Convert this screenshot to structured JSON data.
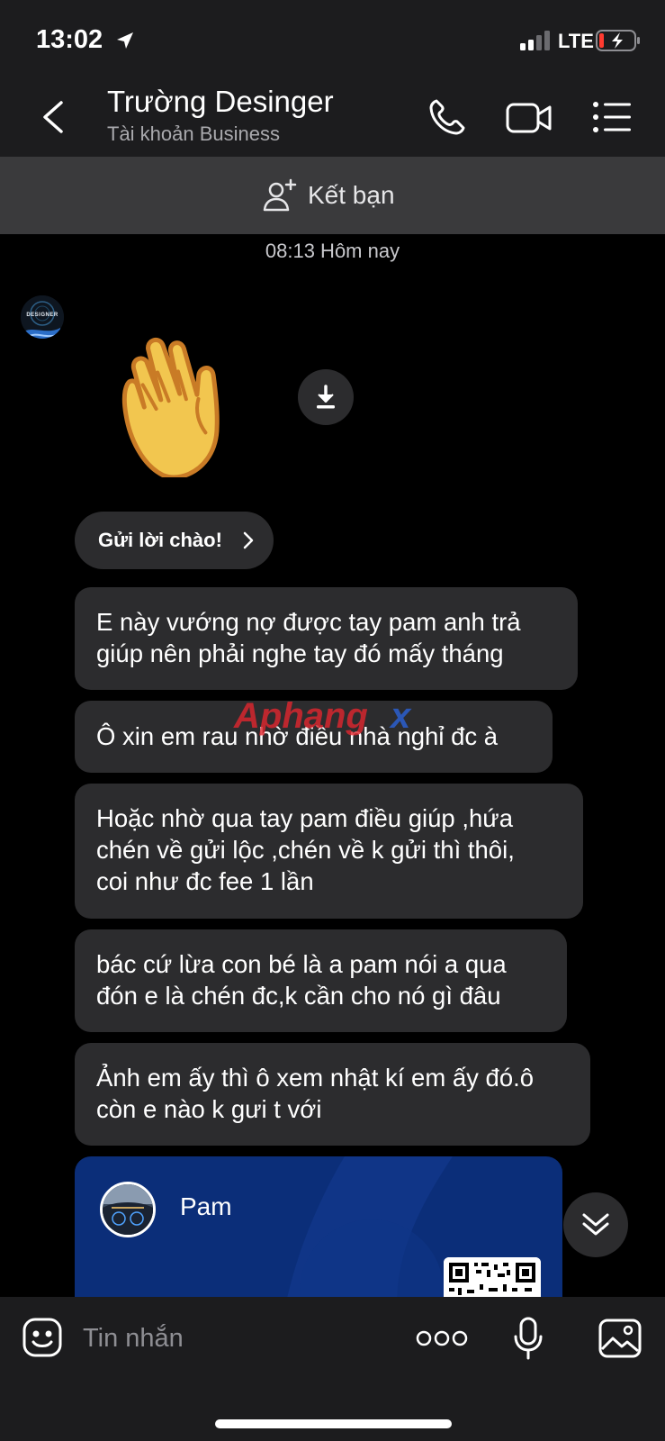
{
  "status_bar": {
    "time": "13:02",
    "network": "LTE"
  },
  "header": {
    "contact_name": "Trường Desinger",
    "contact_subtitle": "Tài khoản Business"
  },
  "add_friend": {
    "label": "Kết bạn"
  },
  "chat": {
    "timestamp": "08:13 Hôm nay",
    "avatar_text": "DESIGNER",
    "greeting_chip": "Gửi lời chào!",
    "messages": [
      {
        "lines": [
          "E này vướng nợ được tay pam anh trả",
          "giúp nên phải nghe tay đó mấy tháng"
        ]
      },
      {
        "lines": [
          "Ô xin em rau nhờ điều nhà nghỉ đc à"
        ]
      },
      {
        "lines": [
          "Hoặc nhờ qua tay pam điều giúp ,hứa",
          "chén về gửi lộc ,chén về k gửi thì thôi,",
          "coi như đc fee 1 lần"
        ]
      },
      {
        "lines": [
          "bác cứ lừa con bé là a pam nói a qua",
          "đón e là chén đc,k cần cho nó gì đâu"
        ]
      },
      {
        "lines": [
          "Ảnh em ấy thì ô xem nhật kí em ấy đó.ô",
          "còn e nào k gưi t với"
        ]
      }
    ],
    "card": {
      "name": "Pam"
    }
  },
  "input": {
    "placeholder": "Tin nhắn"
  },
  "watermark": {
    "text": "Aphangx"
  },
  "colors": {
    "background": "#000000",
    "bar": "#1c1c1e",
    "bubble": "#2c2c2e",
    "add_friend_bar": "#3a3a3c",
    "card": "#0b2e79",
    "battery_low": "#ff3b30"
  },
  "icons": [
    "location-arrow-icon",
    "signal-icon",
    "battery-icon",
    "back-chevron-icon",
    "phone-icon",
    "video-camera-icon",
    "list-menu-icon",
    "add-person-icon",
    "download-icon",
    "chevron-right-icon",
    "double-chevron-down-icon",
    "emoji-icon",
    "more-dots-icon",
    "microphone-icon",
    "image-icon"
  ]
}
